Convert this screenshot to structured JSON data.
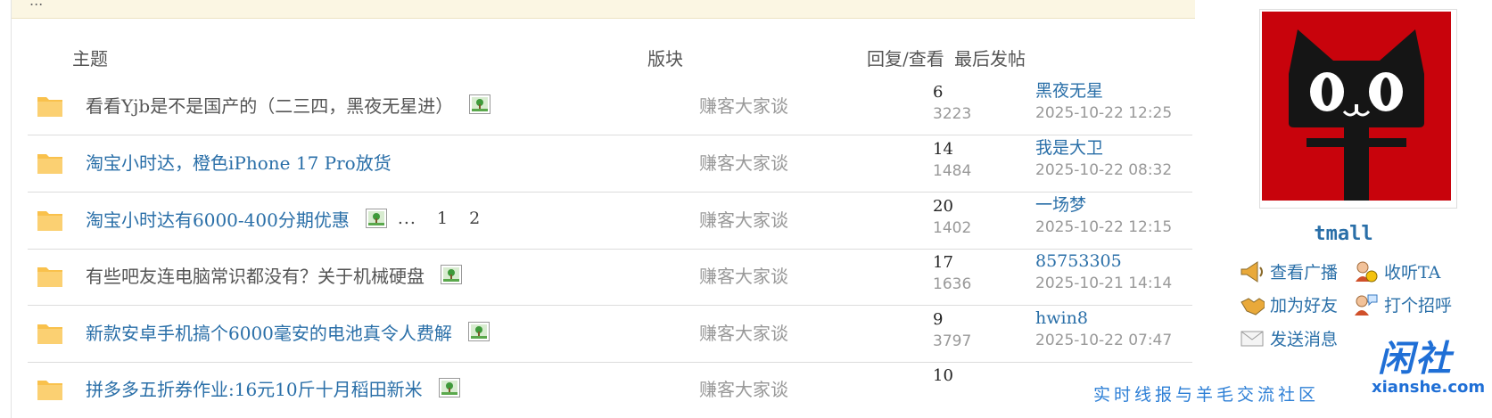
{
  "breadcrumb": {
    "text": "..."
  },
  "table": {
    "headers": {
      "subject": "主题",
      "forum": "版块",
      "replies_views": "回复/查看",
      "last_post": "最后发帖"
    },
    "rows": [
      {
        "title": "看看Yjb是不是国产的（二三四，黑夜无星进）",
        "has_image": true,
        "visited": true,
        "forum": "赚客大家谈",
        "replies": "6",
        "views": "3223",
        "author": "黑夜无星",
        "time": "2025-10-22 12:25"
      },
      {
        "title": "淘宝小时达，橙色iPhone 17 Pro放货",
        "has_image": false,
        "visited": false,
        "forum": "赚客大家谈",
        "replies": "14",
        "views": "1484",
        "author": "我是大卫",
        "time": "2025-10-22 08:32"
      },
      {
        "title": "淘宝小时达有6000-400分期优惠",
        "has_image": true,
        "visited": false,
        "pages": {
          "ellipsis": "...",
          "p1": "1",
          "p2": "2"
        },
        "forum": "赚客大家谈",
        "replies": "20",
        "views": "1402",
        "author": "一场梦",
        "time": "2025-10-22 12:15"
      },
      {
        "title": "有些吧友连电脑常识都没有？关于机械硬盘",
        "has_image": true,
        "visited": true,
        "forum": "赚客大家谈",
        "replies": "17",
        "views": "1636",
        "author": "85753305",
        "time": "2025-10-21 14:14"
      },
      {
        "title": "新款安卓手机搞个6000毫安的电池真令人费解",
        "has_image": true,
        "visited": false,
        "forum": "赚客大家谈",
        "replies": "9",
        "views": "3797",
        "author": "hwin8",
        "time": "2025-10-22 07:47"
      },
      {
        "title": "拼多多五折券作业:16元10斤十月稻田新米",
        "has_image": true,
        "visited": false,
        "forum": "赚客大家谈",
        "replies": "10",
        "views": "",
        "author": "",
        "time": ""
      }
    ]
  },
  "profile": {
    "username": "tmall",
    "actions": {
      "broadcast": "查看广播",
      "follow": "收听TA",
      "add_friend": "加为好友",
      "greet": "打个招呼",
      "message": "发送消息"
    }
  },
  "watermark": {
    "logo_cn": "闲社",
    "logo_en": "xianshe.com",
    "slogan": "实时线报与羊毛交流社区"
  },
  "colors": {
    "link": "#2a6fa8",
    "muted": "#999999",
    "folder": "#f9c14c",
    "avatar_bg": "#c8030c"
  }
}
